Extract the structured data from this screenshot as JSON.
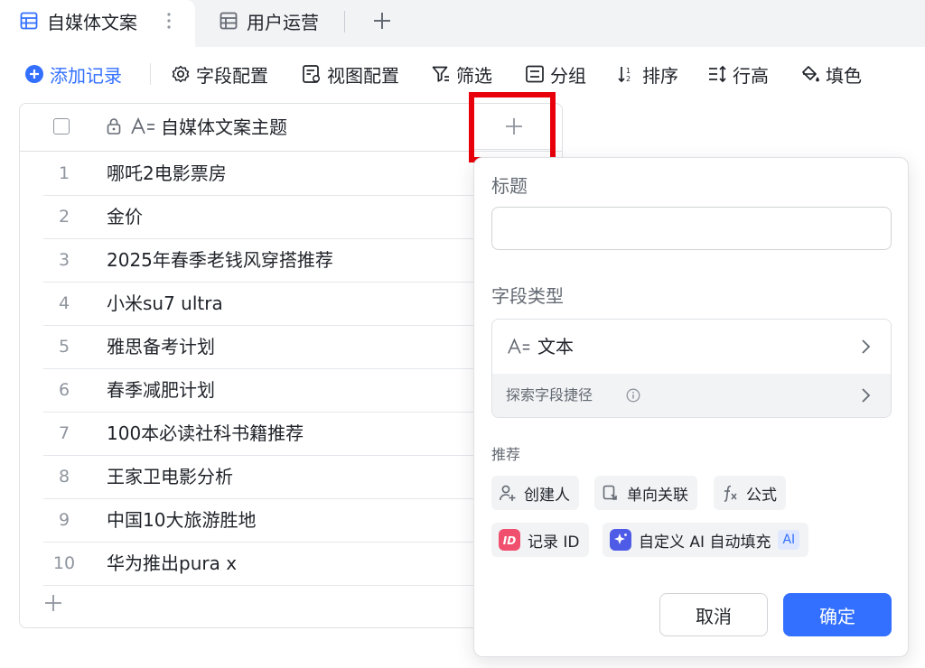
{
  "tabs": [
    {
      "label": "自媒体文案",
      "icon": "table-icon",
      "active": true
    },
    {
      "label": "用户运营",
      "icon": "table-icon",
      "active": false
    }
  ],
  "toolbar": {
    "add_record": "添加记录",
    "field_config": "字段配置",
    "view_config": "视图配置",
    "filter": "筛选",
    "group": "分组",
    "sort": "排序",
    "row_height": "行高",
    "fill_color": "填色"
  },
  "grid": {
    "column_header": "自媒体文案主题",
    "rows": [
      {
        "num": "1",
        "text": "哪吒2电影票房"
      },
      {
        "num": "2",
        "text": "金价"
      },
      {
        "num": "3",
        "text": "2025年春季老钱风穿搭推荐"
      },
      {
        "num": "4",
        "text": "小米su7 ultra"
      },
      {
        "num": "5",
        "text": "雅思备考计划"
      },
      {
        "num": "6",
        "text": "春季减肥计划"
      },
      {
        "num": "7",
        "text": "100本必读社科书籍推荐"
      },
      {
        "num": "8",
        "text": "王家卫电影分析"
      },
      {
        "num": "9",
        "text": "中国10大旅游胜地"
      },
      {
        "num": "10",
        "text": "华为推出pura x"
      }
    ]
  },
  "panel": {
    "title_label": "标题",
    "title_value": "",
    "field_type_label": "字段类型",
    "field_type_value": "文本",
    "explore_label": "探索字段捷径",
    "recommend_label": "推荐",
    "chips": {
      "creator": "创建人",
      "one_way_link": "单向关联",
      "formula": "公式",
      "record_id": "记录 ID",
      "custom_ai": "自定义 AI 自动填充",
      "ai_badge": "AI"
    },
    "cancel": "取消",
    "confirm": "确定"
  },
  "colors": {
    "accent": "#3370ff",
    "highlight": "#e8000b",
    "record_id_icon": "#f0506e",
    "ai_icon": "#4e5be6"
  }
}
